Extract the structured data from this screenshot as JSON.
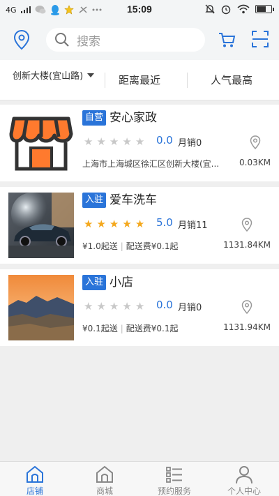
{
  "status_bar": {
    "signal": "4G",
    "time": "15:09"
  },
  "header": {
    "search_placeholder": "搜索"
  },
  "filter": {
    "location": "创新大楼(宜山路)",
    "tabs": [
      "距离最近",
      "人气最高"
    ]
  },
  "shops": [
    {
      "tag": "自营",
      "name": "安心家政",
      "stars": 0,
      "rating": "0.0",
      "sales": "月销0",
      "address": "上海市上海城区徐汇区创新大楼(宜...",
      "distance": "0.03KM"
    },
    {
      "tag": "入驻",
      "name": "爱车洗车",
      "stars": 5,
      "rating": "5.0",
      "sales": "月销11",
      "min_order": "¥1.0起送",
      "delivery": "配送费¥0.1起",
      "distance": "1131.84KM"
    },
    {
      "tag": "入驻",
      "name": "小店",
      "stars": 0,
      "rating": "0.0",
      "sales": "月销0",
      "min_order": "¥0.1起送",
      "delivery": "配送费¥0.1起",
      "distance": "1131.94KM"
    }
  ],
  "tabs": [
    {
      "label": "店铺",
      "icon": "shop-icon",
      "active": true
    },
    {
      "label": "商城",
      "icon": "mall-icon",
      "active": false
    },
    {
      "label": "预约服务",
      "icon": "list-icon",
      "active": false
    },
    {
      "label": "个人中心",
      "icon": "person-icon",
      "active": false
    }
  ],
  "colors": {
    "accent": "#2a74d9",
    "star": "#f4a81d"
  }
}
